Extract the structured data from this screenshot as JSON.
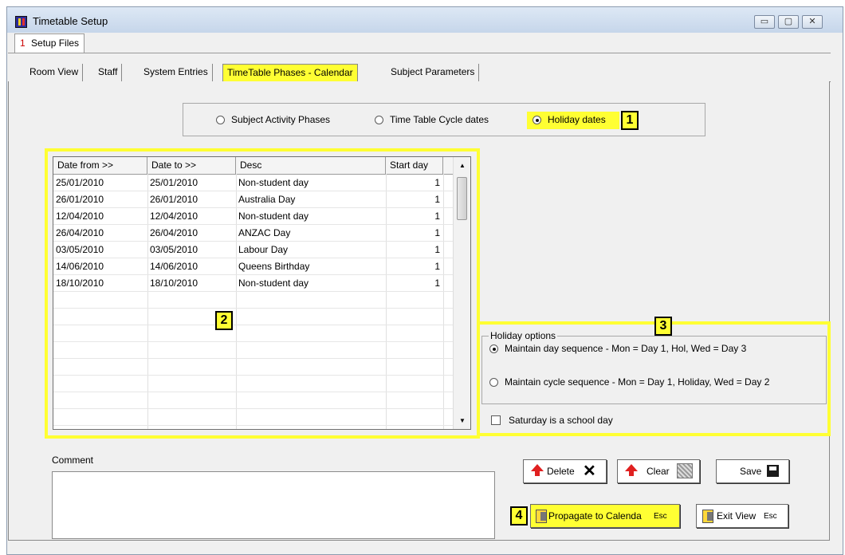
{
  "window": {
    "title": "Timetable Setup",
    "controls": {
      "minimize": "▭",
      "maximize": "▢",
      "close": "✕"
    }
  },
  "outer_tab": {
    "number": "1",
    "label": "Setup Files"
  },
  "tabs": [
    {
      "label": "Room View",
      "active": false
    },
    {
      "label": "Staff",
      "active": false
    },
    {
      "label": "System Entries",
      "active": false
    },
    {
      "label": "TimeTable Phases - Calendar",
      "active": true
    },
    {
      "label": "Subject Parameters",
      "active": false
    }
  ],
  "mode_radios": [
    {
      "label": "Subject Activity Phases",
      "selected": false
    },
    {
      "label": "Time Table Cycle dates",
      "selected": false
    },
    {
      "label": "Holiday dates",
      "selected": true
    }
  ],
  "markers": [
    "1",
    "2",
    "3",
    "4"
  ],
  "grid": {
    "columns": [
      "Date from >>",
      "Date to >>",
      "Desc",
      "Start day"
    ],
    "rows": [
      [
        "25/01/2010",
        "25/01/2010",
        "Non-student day",
        "1"
      ],
      [
        "26/01/2010",
        "26/01/2010",
        "Australia Day",
        "1"
      ],
      [
        "12/04/2010",
        "12/04/2010",
        "Non-student day",
        "1"
      ],
      [
        "26/04/2010",
        "26/04/2010",
        "ANZAC Day",
        "1"
      ],
      [
        "03/05/2010",
        "03/05/2010",
        "Labour Day",
        "1"
      ],
      [
        "14/06/2010",
        "14/06/2010",
        "Queens Birthday",
        "1"
      ],
      [
        "18/10/2010",
        "18/10/2010",
        "Non-student day",
        "1"
      ]
    ]
  },
  "holiday_options": {
    "legend": "Holiday options",
    "options": [
      {
        "label": "Maintain day sequence - Mon = Day 1, Hol, Wed = Day 3",
        "selected": true
      },
      {
        "label": "Maintain cycle sequence - Mon = Day 1, Holiday, Wed = Day 2",
        "selected": false
      }
    ],
    "saturday_checkbox": {
      "label": "Saturday is a school day",
      "checked": false
    }
  },
  "comment": {
    "label": "Comment",
    "value": ""
  },
  "buttons": {
    "delete": "Delete",
    "delete_glyph": "✕",
    "clear": "Clear",
    "save": "Save",
    "propagate": "Propagate to Calenda",
    "propagate_key": "Esc",
    "exit": "Exit View",
    "exit_key": "Esc"
  },
  "colors": {
    "highlight": "#ffff33",
    "arrow": "#e02020",
    "tab_number": "#cc0000"
  }
}
